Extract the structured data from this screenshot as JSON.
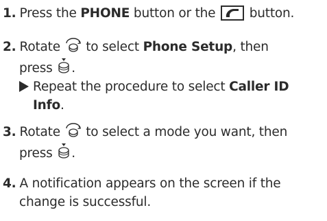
{
  "steps": [
    {
      "num": "1.",
      "t1": "Press the ",
      "t2": "PHONE",
      "t3": " button or the ",
      "t4": " button."
    },
    {
      "num": "2.",
      "t1": "Rotate ",
      "t2": " to select ",
      "t3": "Phone Setup",
      "t4": ", then",
      "l2a": "press ",
      "l2b": "."
    },
    {
      "sub_t1": "Repeat the procedure to select ",
      "sub_b1": "Caller ID",
      "sub_b2": "Info",
      "sub_t2": "."
    },
    {
      "num": "3.",
      "t1": "Rotate ",
      "t2": " to select a mode you want, then",
      "l2a": "press ",
      "l2b": "."
    },
    {
      "num": "4.",
      "t1": "A notification appears on the screen if the",
      "l2": "change is successful."
    }
  ],
  "icons": [
    "phone-button-icon",
    "selector-knob-rotate-icon",
    "selector-knob-press-icon",
    "arrow-bullet-icon"
  ]
}
